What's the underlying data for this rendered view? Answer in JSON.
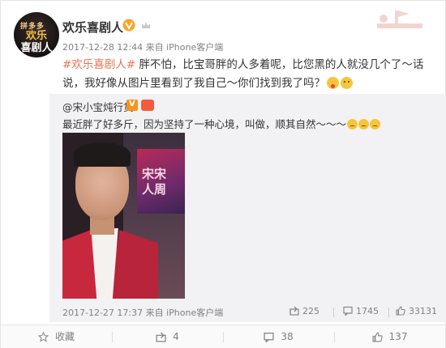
{
  "post": {
    "author": "欢乐喜剧人",
    "avatar_text_top": "拼多多",
    "avatar_text_line1": "欢乐",
    "avatar_text_line2": "喜剧人",
    "timestamp": "2017-12-28 12:44",
    "source": "来自 iPhone客户端",
    "tag": "#欢乐喜剧人#",
    "text": " 胖不怕，比宝哥胖的人多着呢，比您黑的人就没几个了～话说，我好像从图片里看到了我自己～你们找到我了吗？"
  },
  "repost": {
    "user": "@宋小宝炖行货",
    "text": "最近胖了好多斤，因为坚持了一种心境，叫做，顺其自然～～～",
    "photo_screen_text": "宋宋\n人周",
    "timestamp": "2017-12-27 17:37",
    "source": "来自 iPhone客户端",
    "reposts": "225",
    "comments": "1745",
    "likes": "33131"
  },
  "footer": {
    "favorite_label": "收藏",
    "repost_count": "4",
    "comment_count": "38",
    "like_count": "137"
  },
  "colors": {
    "tag": "#eb7350",
    "meta": "#808080"
  }
}
